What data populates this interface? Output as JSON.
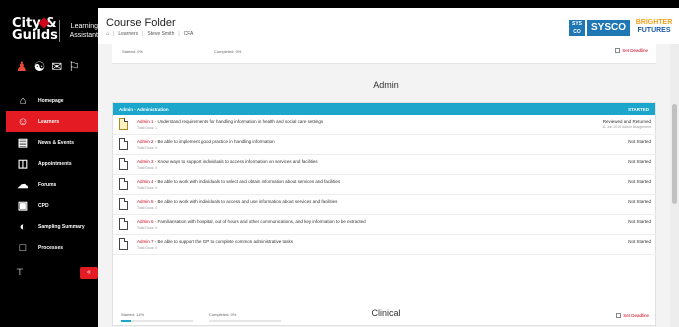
{
  "brand": {
    "name_line1": "City &",
    "name_line2": "Guilds",
    "sub_line1": "Learning",
    "sub_line2": "Assistant"
  },
  "sidebar": {
    "items": [
      {
        "label": "Homepage",
        "icon": "home-icon"
      },
      {
        "label": "Learners",
        "icon": "learners-icon",
        "active": true
      },
      {
        "label": "News & Events",
        "icon": "news-icon"
      },
      {
        "label": "Appointments",
        "icon": "calendar-icon"
      },
      {
        "label": "Forums",
        "icon": "forum-icon"
      },
      {
        "label": "CPD",
        "icon": "cpd-icon"
      },
      {
        "label": "Sampling Summary",
        "icon": "sampling-icon"
      },
      {
        "label": "Processes",
        "icon": "processes-icon"
      }
    ],
    "collapse_label": "«",
    "pin_label": "⊤"
  },
  "header": {
    "title": "Course Folder",
    "breadcrumbs": [
      "Learners",
      "Steve Smith",
      "CFA"
    ],
    "crumb_prefix": "⌂",
    "sysco_box": "SYS CO",
    "sysco_word": "SYSCO",
    "futures_line1": "BRIGHTER",
    "futures_line2": "FUTURES"
  },
  "prev_card": {
    "started": "Started: 0%",
    "completed": "Completed: 0%",
    "deadline": "Set Deadline"
  },
  "sections": {
    "admin": "Admin",
    "clinical": "Clinical"
  },
  "admin_card": {
    "header_title": "Admin - Administration",
    "header_status": "STARTED",
    "units": [
      {
        "code": "Admin 1",
        "title": "Understand requirements for handling information in health and social care settings",
        "sub": "Total Docs: 1",
        "status": "Reviewed and Returned",
        "status_sub": "11 Jun 2019 Admin Assignment"
      },
      {
        "code": "Admin 2",
        "title": "Be able to implement good practice in handling information",
        "sub": "Total Docs: 0",
        "status": "Not Started",
        "status_sub": ""
      },
      {
        "code": "Admin 3",
        "title": "Know ways to support individuals to access information on services and facilities",
        "sub": "Total Docs: 0",
        "status": "Not Started",
        "status_sub": ""
      },
      {
        "code": "Admin 4",
        "title": "Be able to work with individuals to select and obtain information about services and facilities",
        "sub": "Total Docs: 0",
        "status": "Not Started",
        "status_sub": ""
      },
      {
        "code": "Admin 5",
        "title": "Be able to work with individuals to access and use information about services and facilities",
        "sub": "Total Docs: 0",
        "status": "Not Started",
        "status_sub": ""
      },
      {
        "code": "Admin 6",
        "title": "Familiarisation with hospital, out of hours and other communications, and key information to be extracted",
        "sub": "Total Docs: 0",
        "status": "Not Started",
        "status_sub": ""
      },
      {
        "code": "Admin 7",
        "title": "Be able to support the GP to complete common administrative tasks",
        "sub": "Total Docs: 0",
        "status": "Not Started",
        "status_sub": ""
      }
    ],
    "started": "Started: 14%",
    "started_pct": 14,
    "completed": "Completed: 0%",
    "completed_pct": 0,
    "deadline": "Set Deadline"
  },
  "colors": {
    "accent_red": "#e41b23",
    "header_blue": "#1da6cc"
  }
}
